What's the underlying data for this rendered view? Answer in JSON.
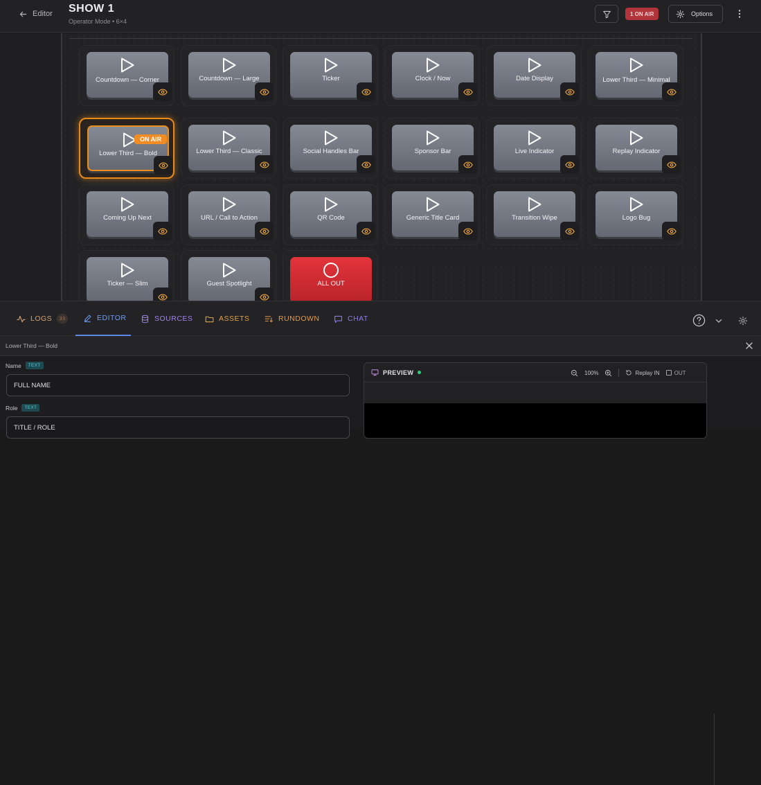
{
  "header": {
    "back_label": "Editor",
    "title": "SHOW 1",
    "subtitle": "Operator Mode • 6×4",
    "onair_badge": "1 ON AIR",
    "options_label": "Options"
  },
  "grid": {
    "columns": 6,
    "rows": 4,
    "live_tag": "ON AIR",
    "cells": [
      {
        "label": "Countdown — Corner",
        "state": "idle"
      },
      {
        "label": "Countdown — Large",
        "state": "idle"
      },
      {
        "label": "Ticker",
        "state": "idle"
      },
      {
        "label": "Clock / Now",
        "state": "idle"
      },
      {
        "label": "Date Display",
        "state": "idle"
      },
      {
        "label": "Lower Third — Minimal",
        "state": "idle"
      },
      {
        "label": "Lower Third — Bold",
        "state": "live"
      },
      {
        "label": "Lower Third — Classic",
        "state": "idle"
      },
      {
        "label": "Social Handles Bar",
        "state": "idle"
      },
      {
        "label": "Sponsor Bar",
        "state": "idle"
      },
      {
        "label": "Live Indicator",
        "state": "idle"
      },
      {
        "label": "Replay Indicator",
        "state": "idle"
      },
      {
        "label": "Coming Up Next",
        "state": "idle"
      },
      {
        "label": "URL / Call to Action",
        "state": "idle"
      },
      {
        "label": "QR Code",
        "state": "idle"
      },
      {
        "label": "Generic Title Card",
        "state": "idle"
      },
      {
        "label": "Transition Wipe",
        "state": "idle"
      },
      {
        "label": "Logo Bug",
        "state": "idle"
      },
      {
        "label": "Ticker — Slim",
        "state": "idle"
      },
      {
        "label": "Guest Spotlight",
        "state": "idle"
      },
      {
        "label": "ALL OUT",
        "state": "all-out"
      }
    ]
  },
  "tabs": {
    "logs": "LOGS",
    "logs_count": "33",
    "editor": "EDITOR",
    "sources": "SOURCES",
    "assets": "ASSETS",
    "rundown": "RUNDOWN",
    "chat": "CHAT"
  },
  "colors": {
    "logs": "#d8a070",
    "editor": "#6e9cf5",
    "sources": "#9c84e8",
    "assets": "#e0a050",
    "rundown": "#e39a4a",
    "chat": "#8c7ce8",
    "onair": "#f08c24",
    "allout": "#dc2f36"
  },
  "editor_panel": {
    "title": "Lower Third — Bold",
    "fields": [
      {
        "label": "Name",
        "type": "TEXT",
        "value": "FULL NAME"
      },
      {
        "label": "Role",
        "type": "TEXT",
        "value": "TITLE / ROLE"
      }
    ]
  },
  "preview": {
    "title": "PREVIEW",
    "zoom": "100%",
    "replay_label": "Replay IN",
    "out_label": "OUT"
  }
}
